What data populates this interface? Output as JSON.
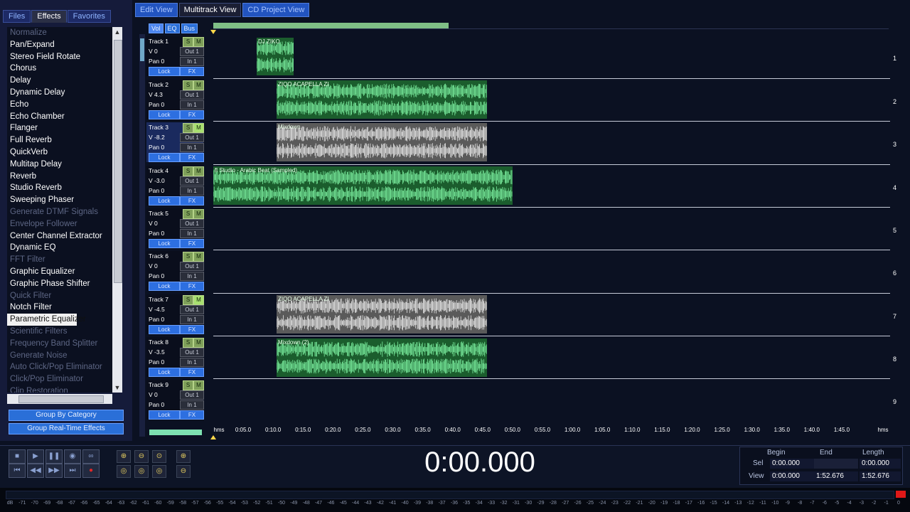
{
  "left_panel": {
    "tabs": [
      {
        "label": "Files"
      },
      {
        "label": "Effects"
      },
      {
        "label": "Favorites"
      }
    ],
    "effects": [
      {
        "label": "Normalize",
        "enabled": false
      },
      {
        "label": "Pan/Expand",
        "enabled": true
      },
      {
        "label": "Stereo Field Rotate",
        "enabled": true
      },
      {
        "label": "Chorus",
        "enabled": true
      },
      {
        "label": "Delay",
        "enabled": true
      },
      {
        "label": "Dynamic Delay",
        "enabled": true
      },
      {
        "label": "Echo",
        "enabled": true
      },
      {
        "label": "Echo Chamber",
        "enabled": true
      },
      {
        "label": "Flanger",
        "enabled": true
      },
      {
        "label": "Full Reverb",
        "enabled": true
      },
      {
        "label": "QuickVerb",
        "enabled": true
      },
      {
        "label": "Multitap Delay",
        "enabled": true
      },
      {
        "label": "Reverb",
        "enabled": true
      },
      {
        "label": "Studio Reverb",
        "enabled": true
      },
      {
        "label": "Sweeping Phaser",
        "enabled": true
      },
      {
        "label": "Generate DTMF Signals",
        "enabled": false
      },
      {
        "label": "Envelope Follower",
        "enabled": false
      },
      {
        "label": "Center Channel Extractor",
        "enabled": true
      },
      {
        "label": "Dynamic EQ",
        "enabled": true
      },
      {
        "label": "FFT Filter",
        "enabled": false
      },
      {
        "label": "Graphic Equalizer",
        "enabled": true
      },
      {
        "label": "Graphic Phase Shifter",
        "enabled": true
      },
      {
        "label": "Quick Filter",
        "enabled": false
      },
      {
        "label": "Notch Filter",
        "enabled": true
      },
      {
        "label": "Parametric Equalizer",
        "enabled": true,
        "selected": true
      },
      {
        "label": "Scientific Filters",
        "enabled": false
      },
      {
        "label": "Frequency Band Splitter",
        "enabled": false
      },
      {
        "label": "Generate Noise",
        "enabled": false
      },
      {
        "label": "Auto Click/Pop Eliminator",
        "enabled": false
      },
      {
        "label": "Click/Pop Eliminator",
        "enabled": false
      },
      {
        "label": "Clip Restoration",
        "enabled": false
      }
    ],
    "group_by_category": "Group By Category",
    "group_realtime": "Group Real-Time Effects"
  },
  "view_tabs": [
    {
      "label": "Edit View"
    },
    {
      "label": "Multitrack View"
    },
    {
      "label": "CD Project View"
    }
  ],
  "header_buttons": [
    "Vol",
    "EQ",
    "Bus"
  ],
  "tracks": [
    {
      "name": "Track 1",
      "volume": "V 0",
      "pan": "Pan 0",
      "out": "Out 1",
      "in": "In 1",
      "lock": "Lock",
      "fx": "FX",
      "solo": "S",
      "mute": "M",
      "number": "1"
    },
    {
      "name": "Track 2",
      "volume": "V 4.3",
      "pan": "Pan 0",
      "out": "Out 1",
      "in": "In 1",
      "lock": "Lock",
      "fx": "FX",
      "solo": "S",
      "mute": "M",
      "number": "2"
    },
    {
      "name": "Track 3",
      "volume": "V -8.2",
      "pan": "Pan 0",
      "out": "Out 1",
      "in": "In 1",
      "lock": "Lock",
      "fx": "FX",
      "solo": "S",
      "mute": "M",
      "number": "3"
    },
    {
      "name": "Track 4",
      "volume": "V -3.0",
      "pan": "Pan 0",
      "out": "Out 1",
      "in": "In 1",
      "lock": "Lock",
      "fx": "FX",
      "solo": "S",
      "mute": "M",
      "number": "4"
    },
    {
      "name": "Track 5",
      "volume": "V 0",
      "pan": "Pan 0",
      "out": "Out 1",
      "in": "In 1",
      "lock": "Lock",
      "fx": "FX",
      "solo": "S",
      "mute": "M",
      "number": "5"
    },
    {
      "name": "Track 6",
      "volume": "V 0",
      "pan": "Pan 0",
      "out": "Out 1",
      "in": "In 1",
      "lock": "Lock",
      "fx": "FX",
      "solo": "S",
      "mute": "M",
      "number": "6"
    },
    {
      "name": "Track 7",
      "volume": "V -4.5",
      "pan": "Pan 0",
      "out": "Out 1",
      "in": "In 1",
      "lock": "Lock",
      "fx": "FX",
      "solo": "S",
      "mute": "M",
      "number": "7"
    },
    {
      "name": "Track 8",
      "volume": "V -3.5",
      "pan": "Pan 0",
      "out": "Out 1",
      "in": "In 1",
      "lock": "Lock",
      "fx": "FX",
      "solo": "S",
      "mute": "M",
      "number": "8"
    },
    {
      "name": "Track 9",
      "volume": "V 0",
      "pan": "Pan 0",
      "out": "Out 1",
      "in": "In 1",
      "lock": "Lock",
      "fx": "FX",
      "solo": "S",
      "mute": "M",
      "number": "9"
    }
  ],
  "clips": {
    "dj_ziko": "DJ ZIKO",
    "acapella": "ZIQO ACAPELLA ZI",
    "mixdown": "Mixdown",
    "studio": "fl Studio - Arabic Beat (Sampled)",
    "mixdown2": "Mixdown (2)"
  },
  "ruler": [
    "hms",
    "0:05.0",
    "0:10.0",
    "0:15.0",
    "0:20.0",
    "0:25.0",
    "0:30.0",
    "0:35.0",
    "0:40.0",
    "0:45.0",
    "0:50.0",
    "0:55.0",
    "1:00.0",
    "1:05.0",
    "1:10.0",
    "1:15.0",
    "1:20.0",
    "1:25.0",
    "1:30.0",
    "1:35.0",
    "1:40.0",
    "1:45.0",
    "hms"
  ],
  "time": "0:00.000",
  "selection": {
    "begin_label": "Begin",
    "end_label": "End",
    "length_label": "Length",
    "sel_label": "Sel",
    "view_label": "View",
    "sel_begin": "0:00.000",
    "sel_length": "0:00.000",
    "view_begin": "0:00.000",
    "view_end": "1:52.676",
    "view_length": "1:52.676"
  },
  "meter_scale": [
    "dB",
    "-71",
    "-70",
    "-69",
    "-68",
    "-67",
    "-66",
    "-65",
    "-64",
    "-63",
    "-62",
    "-61",
    "-60",
    "-59",
    "-58",
    "-57",
    "-56",
    "-55",
    "-54",
    "-53",
    "-52",
    "-51",
    "-50",
    "-49",
    "-48",
    "-47",
    "-46",
    "-45",
    "-44",
    "-43",
    "-42",
    "-41",
    "-40",
    "-39",
    "-38",
    "-37",
    "-36",
    "-35",
    "-34",
    "-33",
    "-32",
    "-31",
    "-30",
    "-29",
    "-28",
    "-27",
    "-26",
    "-25",
    "-24",
    "-23",
    "-22",
    "-21",
    "-20",
    "-19",
    "-18",
    "-17",
    "-16",
    "-15",
    "-14",
    "-13",
    "-12",
    "-11",
    "-10",
    "-9",
    "-8",
    "-7",
    "-6",
    "-5",
    "-4",
    "-3",
    "-2",
    "-1",
    "0"
  ],
  "colors": {
    "accent": "#2a6fd8",
    "clip_green": "#1b5d2d",
    "wave_green": "#7cf0a0",
    "clip_gray": "#5a5a5a",
    "wave_gray": "#e8e8e8"
  },
  "icons": {
    "stop": "stop-icon",
    "play": "play-icon",
    "pause": "pause-icon",
    "play_from_cursor": "play-from-cursor-icon",
    "loop": "loop-icon",
    "go_start": "go-to-start-icon",
    "rewind": "rewind-icon",
    "fast_forward": "fast-forward-icon",
    "go_end": "go-to-end-icon",
    "record": "record-icon"
  }
}
